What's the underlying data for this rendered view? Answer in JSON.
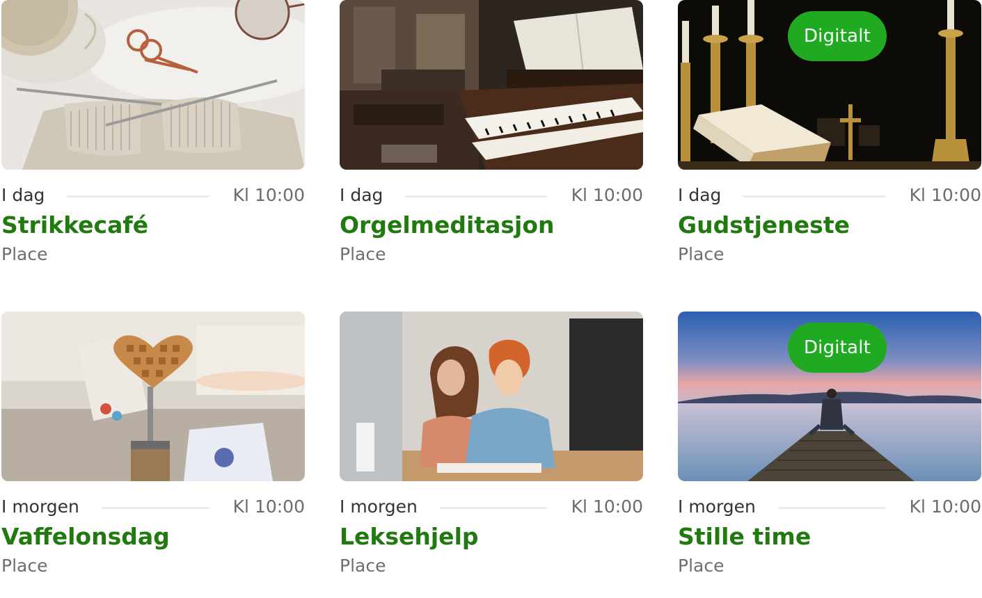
{
  "events": [
    {
      "day": "I dag",
      "time": "Kl 10:00",
      "title": "Strikkecafé",
      "place": "Place",
      "badge": "",
      "image": "knitting-photo"
    },
    {
      "day": "I dag",
      "time": "Kl 10:00",
      "title": "Orgelmeditasjon",
      "place": "Place",
      "badge": "",
      "image": "organ-photo"
    },
    {
      "day": "I dag",
      "time": "Kl 10:00",
      "title": "Gudstjeneste",
      "place": "Place",
      "badge": "Digitalt",
      "image": "altar-bible-photo"
    },
    {
      "day": "I morgen",
      "time": "Kl 10:00",
      "title": "Vaffelonsdag",
      "place": "Place",
      "badge": "",
      "image": "heart-waffle-photo"
    },
    {
      "day": "I morgen",
      "time": "Kl 10:00",
      "title": "Leksehjelp",
      "place": "Place",
      "badge": "",
      "image": "homework-photo"
    },
    {
      "day": "I morgen",
      "time": "Kl 10:00",
      "title": "Stille time",
      "place": "Place",
      "badge": "Digitalt",
      "image": "lake-pier-photo"
    }
  ],
  "colors": {
    "title": "#217a10",
    "badge": "#1faa22",
    "rule": "#e4efe4"
  }
}
